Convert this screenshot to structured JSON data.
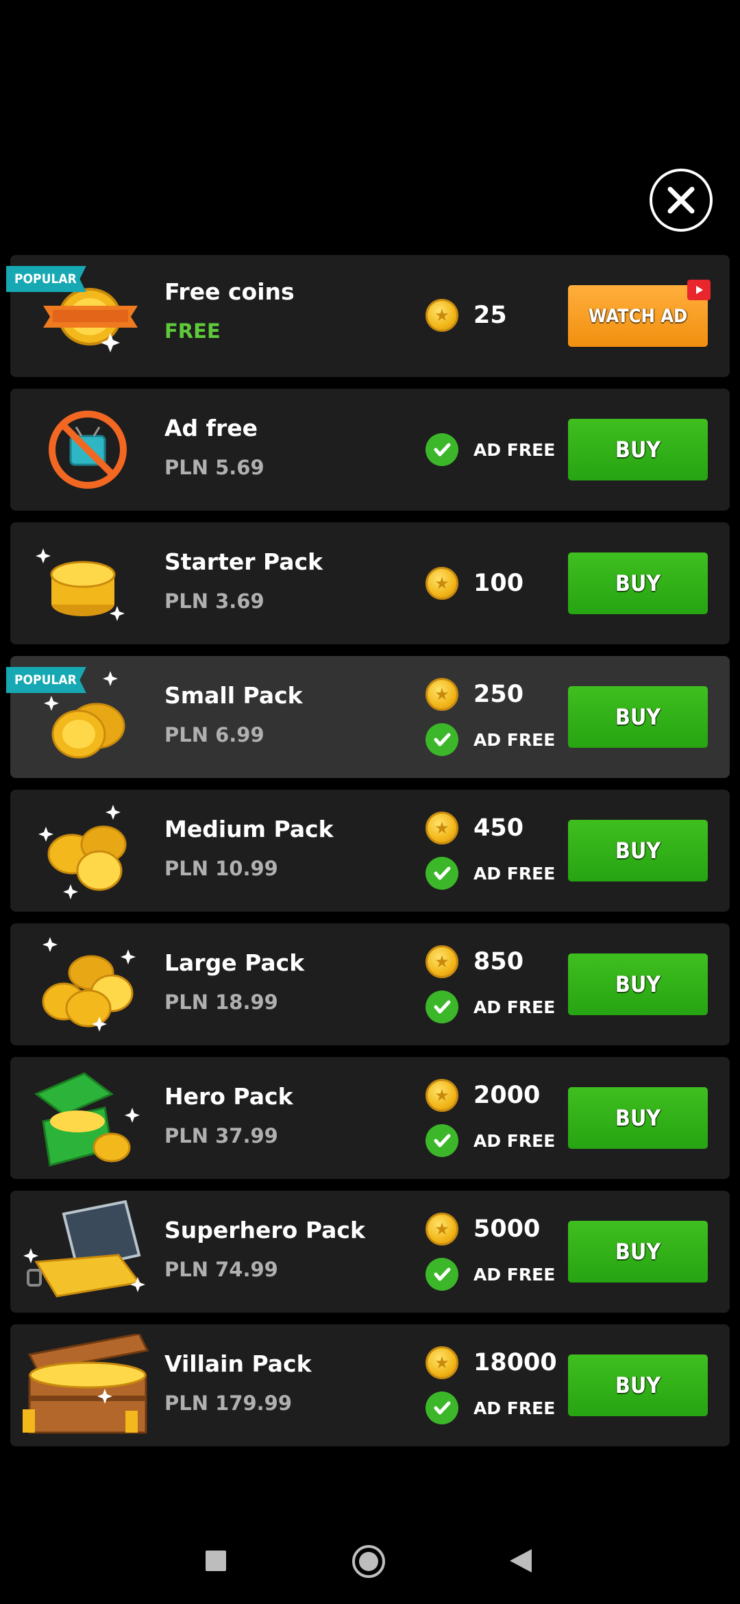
{
  "items": [
    {
      "name": "Free coins",
      "price": "FREE",
      "price_free": true,
      "badge": "POPULAR",
      "coins": "25",
      "ad_free": "",
      "button": "WATCH AD",
      "button_type": "watch",
      "highlight": true,
      "image": "coin-ribbon-icon"
    },
    {
      "name": "Ad free",
      "price": "PLN 5.69",
      "badge": "",
      "coins": "",
      "ad_free": "AD FREE",
      "button": "BUY",
      "button_type": "buy",
      "highlight": false,
      "image": "no-tv-icon"
    },
    {
      "name": "Starter Pack",
      "price": "PLN 3.69",
      "badge": "",
      "coins": "100",
      "ad_free": "",
      "button": "BUY",
      "button_type": "buy",
      "highlight": false,
      "image": "coin-stack-icon"
    },
    {
      "name": "Small Pack",
      "price": "PLN 6.99",
      "badge": "POPULAR",
      "coins": "250",
      "ad_free": "AD FREE",
      "button": "BUY",
      "button_type": "buy",
      "highlight": true,
      "image": "coin-stack-icon"
    },
    {
      "name": "Medium Pack",
      "price": "PLN 10.99",
      "badge": "",
      "coins": "450",
      "ad_free": "AD FREE",
      "button": "BUY",
      "button_type": "buy",
      "highlight": false,
      "image": "coin-pile-icon"
    },
    {
      "name": "Large Pack",
      "price": "PLN 18.99",
      "badge": "",
      "coins": "850",
      "ad_free": "AD FREE",
      "button": "BUY",
      "button_type": "buy",
      "highlight": false,
      "image": "coin-pile-large-icon"
    },
    {
      "name": "Hero Pack",
      "price": "PLN 37.99",
      "badge": "",
      "coins": "2000",
      "ad_free": "AD FREE",
      "button": "BUY",
      "button_type": "buy",
      "highlight": false,
      "image": "coin-box-icon"
    },
    {
      "name": "Superhero Pack",
      "price": "PLN 74.99",
      "badge": "",
      "coins": "5000",
      "ad_free": "AD FREE",
      "button": "BUY",
      "button_type": "buy",
      "highlight": false,
      "image": "coin-briefcase-icon"
    },
    {
      "name": "Villain Pack",
      "price": "PLN 179.99",
      "badge": "",
      "coins": "18000",
      "ad_free": "AD FREE",
      "button": "BUY",
      "button_type": "buy",
      "highlight": false,
      "image": "treasure-chest-icon"
    }
  ],
  "colors": {
    "buy": "#2fb21a",
    "watch": "#f7a02a",
    "free": "#5ec93a",
    "badge": "#17a9b3",
    "row": "#1e1e1e",
    "row_highlight": "#333333"
  },
  "close_icon": "close-icon",
  "navbar": {
    "icons": [
      "recents-icon",
      "home-icon",
      "back-icon"
    ]
  }
}
